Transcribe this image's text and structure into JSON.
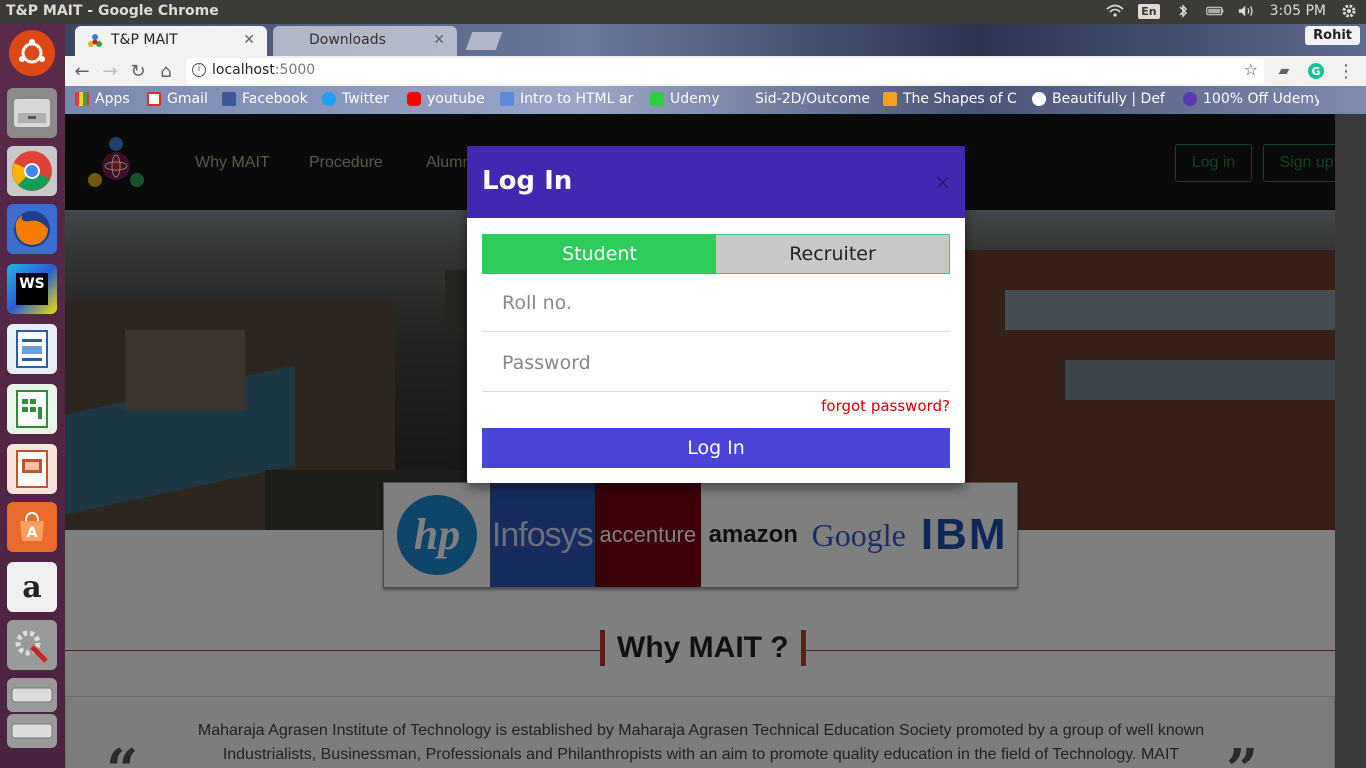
{
  "os": {
    "window_title": "T&P MAIT - Google Chrome",
    "lang": "En",
    "time": "3:05 PM",
    "icons": [
      "wifi-icon",
      "keyboard-lang-icon",
      "bluetooth-icon",
      "battery-icon",
      "volume-icon",
      "settings-gear-icon"
    ]
  },
  "launcher": {
    "items": [
      "ubuntu-dash",
      "files",
      "chrome",
      "firefox",
      "webstorm",
      "libreoffice-writer",
      "libreoffice-calc",
      "libreoffice-impress",
      "software-center",
      "amazon",
      "system-settings",
      "disk-1",
      "disk-2"
    ],
    "webstorm_label": "WS",
    "amazon_label": "a"
  },
  "browser": {
    "tabs": [
      {
        "label": "T&P MAIT",
        "active": true
      },
      {
        "label": "Downloads",
        "active": false
      }
    ],
    "profile": "Rohit",
    "url_host": "localhost",
    "url_port": ":5000",
    "bookmarks": [
      "Apps",
      "Gmail",
      "Facebook",
      "Twitter",
      "youtube",
      "Intro to HTML ar",
      "Udemy",
      "Sid-2D/Outcome",
      "The Shapes of C",
      "Beautifully | Def",
      "100% Off Udemy"
    ]
  },
  "site": {
    "nav": [
      "Why MAIT",
      "Procedure",
      "Alumni"
    ],
    "login_label": "Log in",
    "signup_label": "Sign up",
    "companies": [
      "hp",
      "Infosys",
      "accenture",
      "amazon",
      "Google",
      "IBM"
    ],
    "why_title": "Why MAIT ?",
    "about_text": "Maharaja Agrasen Institute of Technology is established by Maharaja Agrasen Technical Education Society promoted by a group of well known Industrialists, Businessman, Professionals and Philanthropists with an aim to promote quality education in the field of Technology. MAIT",
    "quote_open": "“",
    "quote_close": "”"
  },
  "modal": {
    "title": "Log In",
    "close": "×",
    "tab_student": "Student",
    "tab_recruiter": "Recruiter",
    "roll_placeholder": "Roll no.",
    "password_placeholder": "Password",
    "forgot": "forgot password?",
    "submit": "Log In"
  },
  "colors": {
    "modal_header": "#4228b0",
    "active_tab": "#2ecc5a",
    "submit": "#4b44d8",
    "accent_red": "#c0392b",
    "auth_green": "#1e8a3a"
  }
}
